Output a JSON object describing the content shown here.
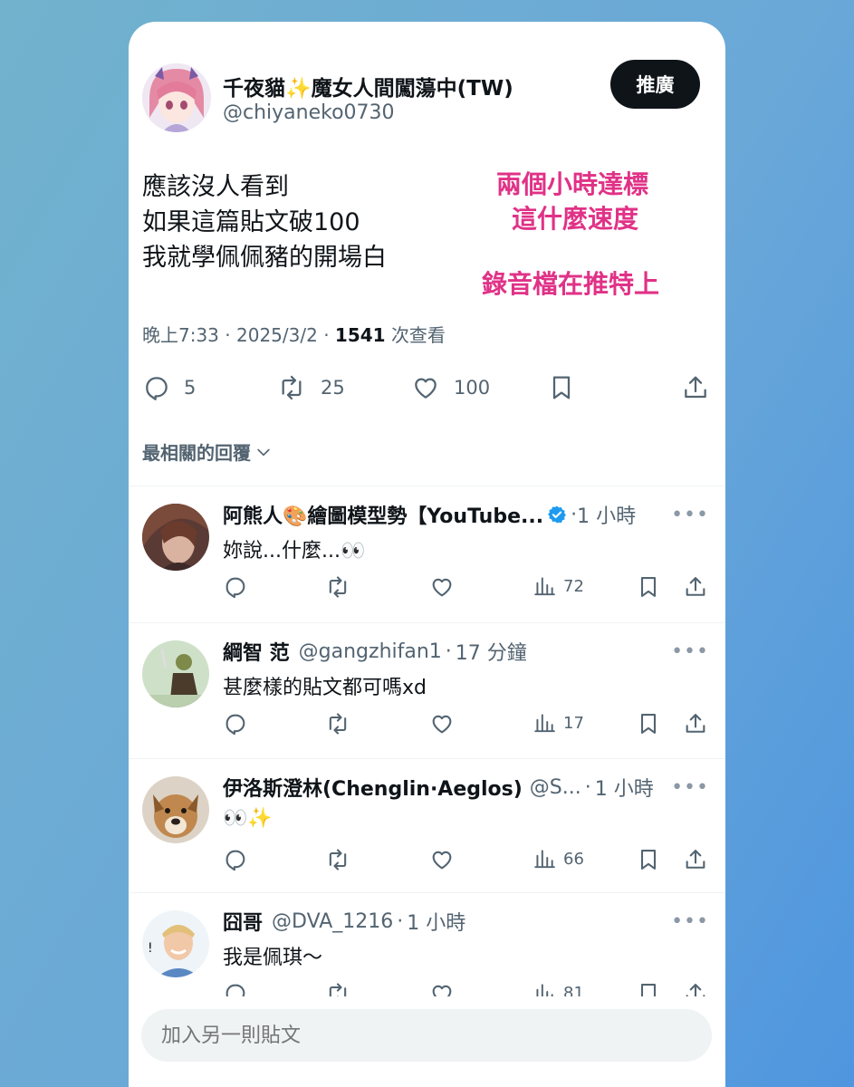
{
  "main_tweet": {
    "display_name": "千夜貓✨魔女人間闖蕩中(TW)",
    "handle": "@chiyaneko0730",
    "promote_label": "推廣",
    "text_lines": [
      "應該沒人看到",
      "如果這篇貼文破100",
      "我就學佩佩豬的開場白"
    ],
    "annotations": [
      "兩個小時達標",
      "這什麼速度",
      "錄音檔在推特上"
    ],
    "time": "晚上7:33",
    "date": "2025/3/2",
    "views_count": "1541",
    "views_label": "次查看",
    "replies": "5",
    "retweets": "25",
    "likes": "100"
  },
  "sort_label": "最相關的回覆",
  "replies": [
    {
      "name": "阿熊人🎨繪圖模型勢【YouTube...",
      "verified": true,
      "handle": "",
      "time": "1 小時",
      "text": "妳說...什麼...👀",
      "views": "72"
    },
    {
      "name": "綱智 范",
      "verified": false,
      "handle": "@gangzhifan1",
      "time": "17 分鐘",
      "text": "甚麼樣的貼文都可嗎xd",
      "views": "17"
    },
    {
      "name": "伊洛斯澄林(Chenglin·Aeglos)",
      "verified": false,
      "handle": "@S...",
      "time": "1 小時",
      "text": "👀✨",
      "views": "66"
    },
    {
      "name": "囧哥",
      "verified": false,
      "handle": "@DVA_1216",
      "time": "1 小時",
      "text": "我是佩琪～",
      "views": "81"
    }
  ],
  "compose_placeholder": "加入另一則貼文",
  "colors": {
    "accent": "#e03287",
    "verified": "#1d9bf0",
    "muted": "#536471"
  }
}
